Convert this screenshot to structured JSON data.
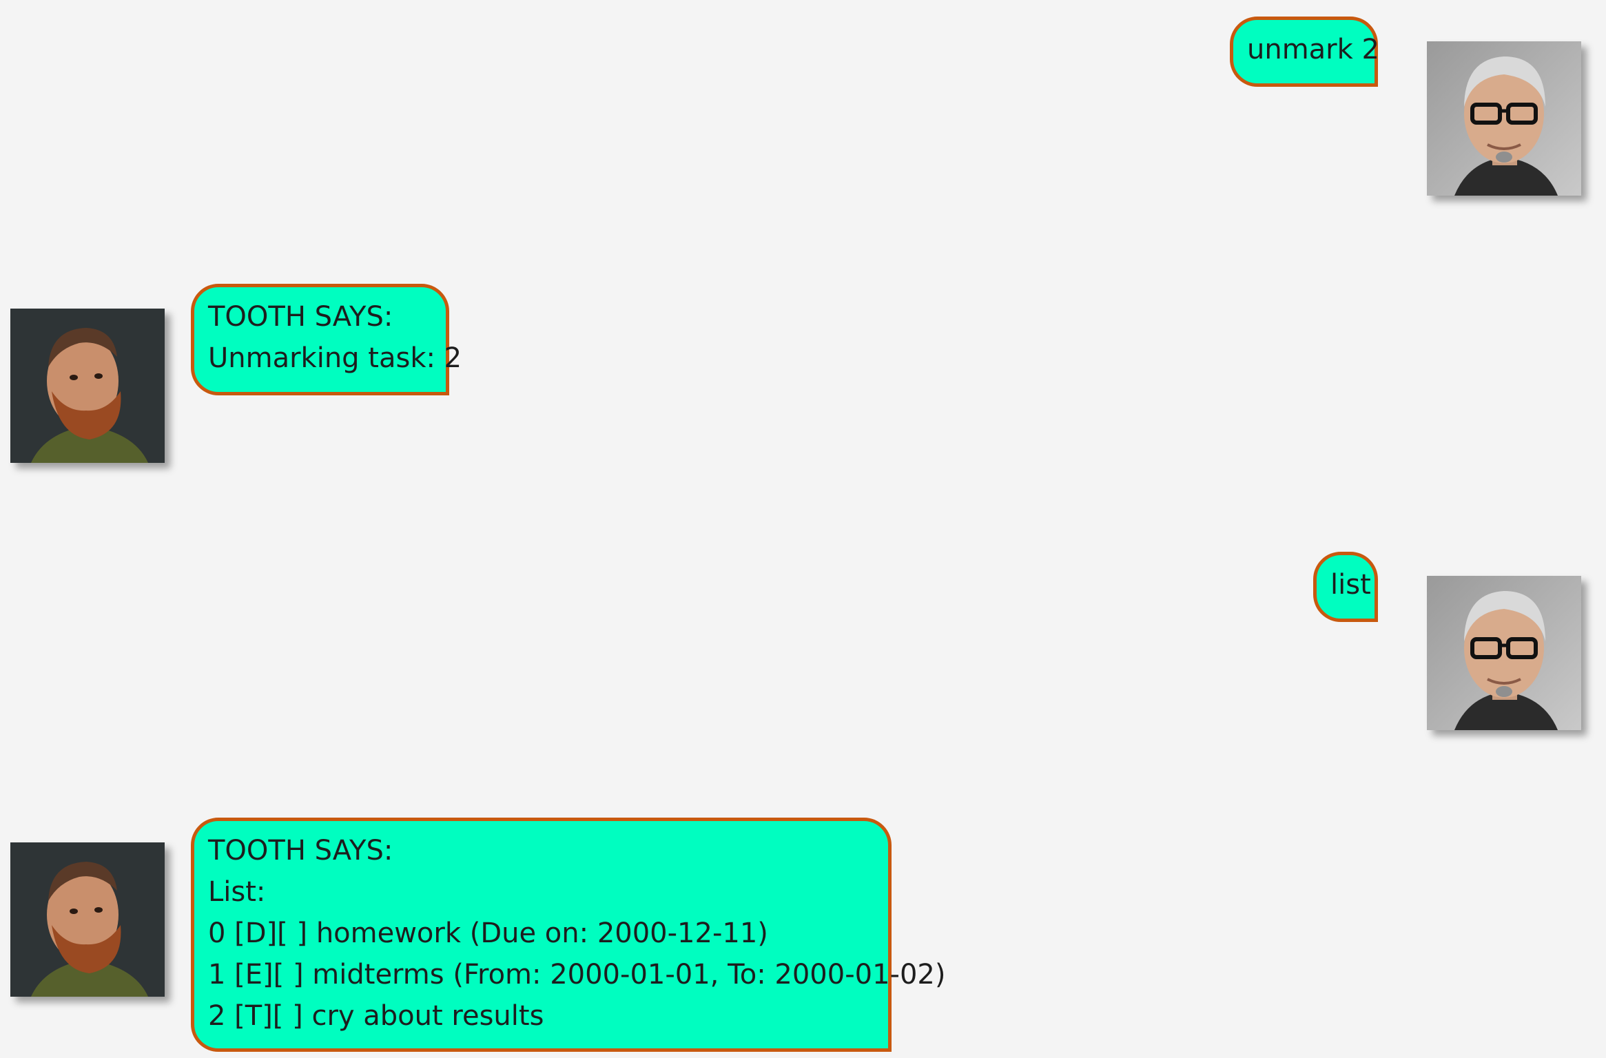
{
  "messages": [
    {
      "sender": "user",
      "avatar": "user-avatar",
      "lines": [
        "unmark 2"
      ]
    },
    {
      "sender": "bot",
      "avatar": "bot-avatar",
      "lines": [
        "TOOTH SAYS:",
        "Unmarking task: 2"
      ]
    },
    {
      "sender": "user",
      "avatar": "user-avatar",
      "lines": [
        "list"
      ]
    },
    {
      "sender": "bot",
      "avatar": "bot-avatar",
      "lines": [
        "TOOTH SAYS:",
        "List:",
        "0 [D][ ] homework (Due on: 2000-12-11)",
        "1 [E][ ] midterms (From: 2000-01-01, To: 2000-01-02)",
        "2 [T][ ] cry about results"
      ]
    }
  ],
  "colors": {
    "background": "#f4f4f4",
    "bubble_fill": "#00fec0",
    "bubble_border": "#c8590f",
    "text": "#1d1d1d"
  }
}
